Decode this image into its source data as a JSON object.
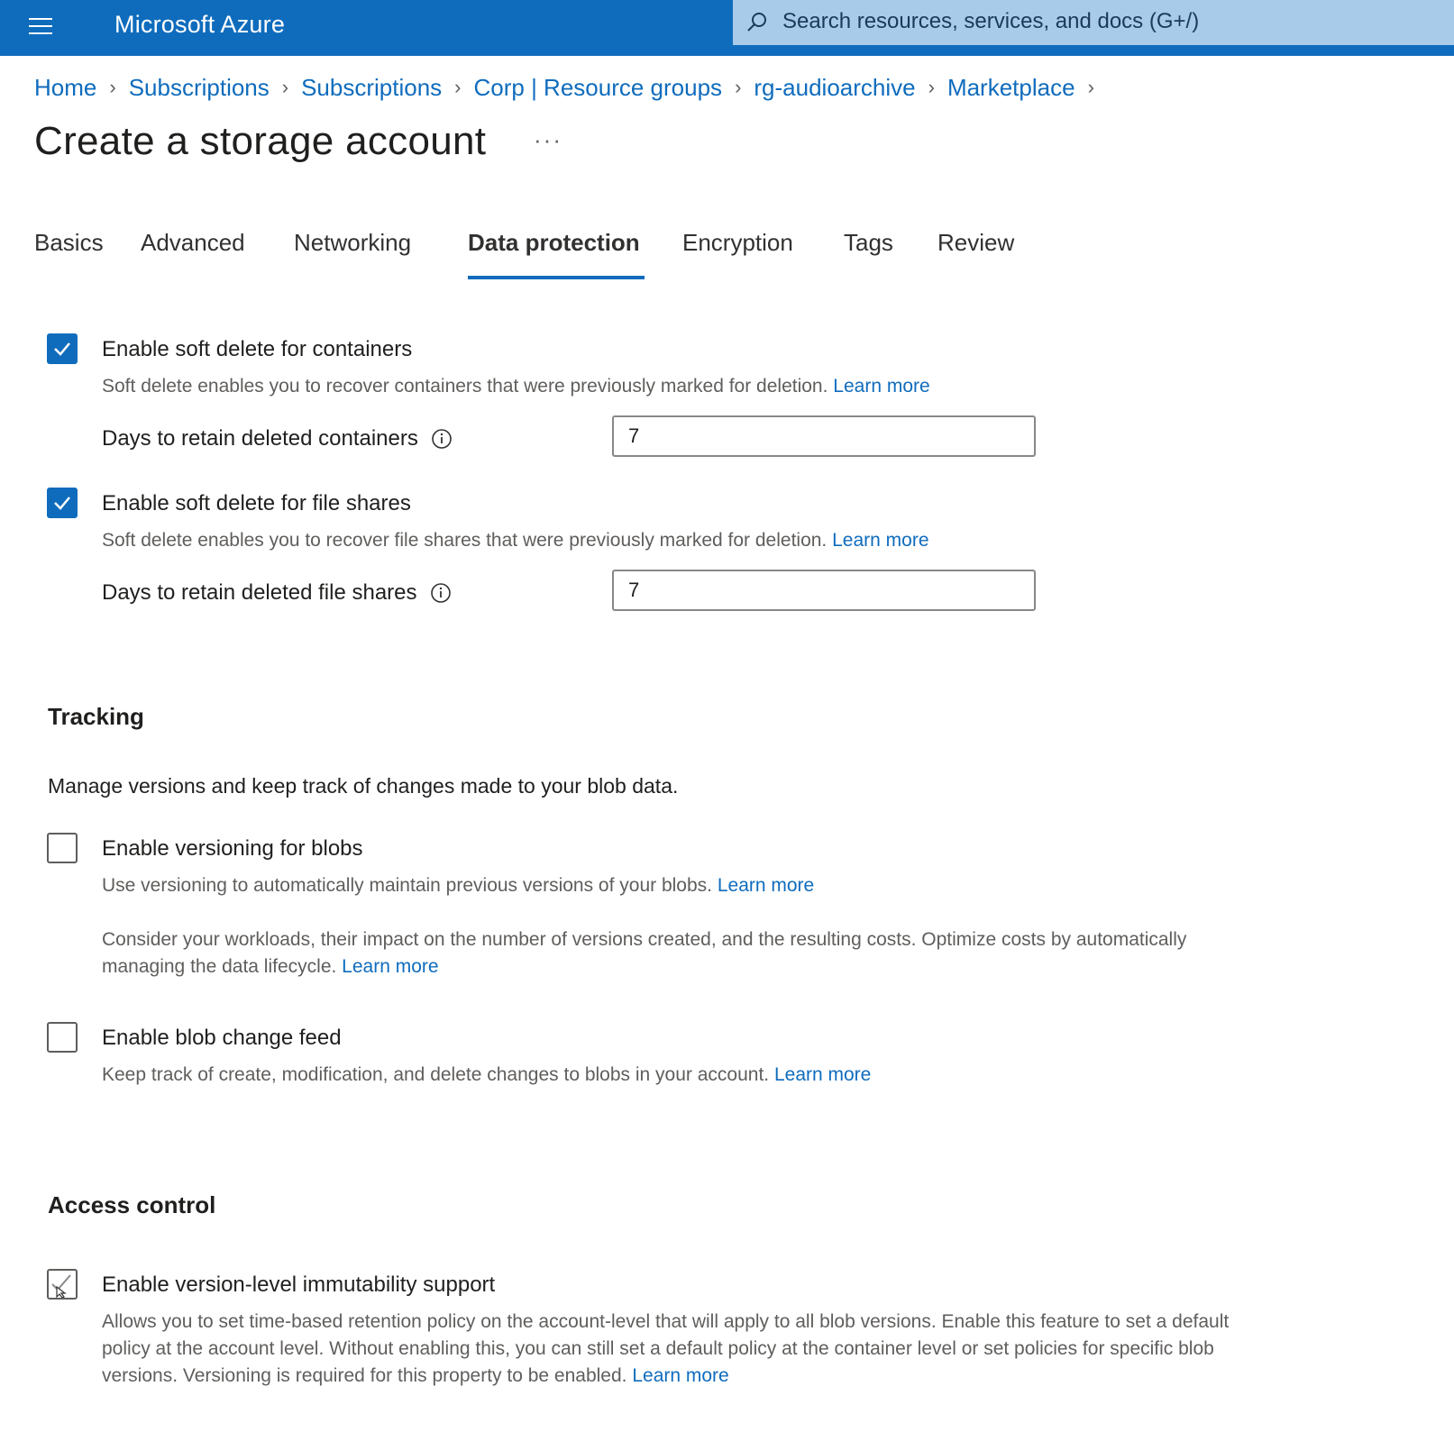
{
  "header": {
    "brand": "Microsoft Azure",
    "search_placeholder": "Search resources, services, and docs (G+/)",
    "accent": "#0f6cbd"
  },
  "breadcrumb": [
    "Home",
    "Subscriptions",
    "Subscriptions",
    "Corp | Resource groups",
    "rg-audioarchive",
    "Marketplace"
  ],
  "page": {
    "title": "Create a storage account",
    "more": "···"
  },
  "tabs": [
    "Basics",
    "Advanced",
    "Networking",
    "Data protection",
    "Encryption",
    "Tags",
    "Review"
  ],
  "active_tab": "Data protection",
  "recovery": {
    "containers": {
      "checked": true,
      "label": "Enable soft delete for containers",
      "desc": "Soft delete enables you to recover containers that were previously marked for deletion.",
      "link": "Learn more",
      "days_label": "Days to retain deleted containers",
      "days_value": "7"
    },
    "file_shares": {
      "checked": true,
      "label": "Enable soft delete for file shares",
      "desc": "Soft delete enables you to recover file shares that were previously marked for deletion.",
      "link": "Learn more",
      "days_label": "Days to retain deleted file shares",
      "days_value": "7"
    }
  },
  "tracking": {
    "heading": "Tracking",
    "desc": "Manage versions and keep track of changes made to your blob data.",
    "versioning": {
      "checked": false,
      "label": "Enable versioning for blobs",
      "desc": "Use versioning to automatically maintain previous versions of your blobs.",
      "link": "Learn more",
      "note": "Consider your workloads, their impact on the number of versions created, and the resulting costs. Optimize costs by automatically managing the data lifecycle.",
      "note_link": "Learn more"
    },
    "change_feed": {
      "checked": false,
      "label": "Enable blob change feed",
      "desc": "Keep track of create, modification, and delete changes to blobs in your account.",
      "link": "Learn more"
    }
  },
  "access_control": {
    "heading": "Access control",
    "immutability": {
      "checked": false,
      "label": "Enable version-level immutability support",
      "desc": "Allows you to set time-based retention policy on the account-level that will apply to all blob versions. Enable this feature to set a default policy at the account level. Without enabling this, you can still set a default policy at the container level or set policies for specific blob versions. Versioning is required for this property to be enabled.",
      "link": "Learn more"
    }
  }
}
